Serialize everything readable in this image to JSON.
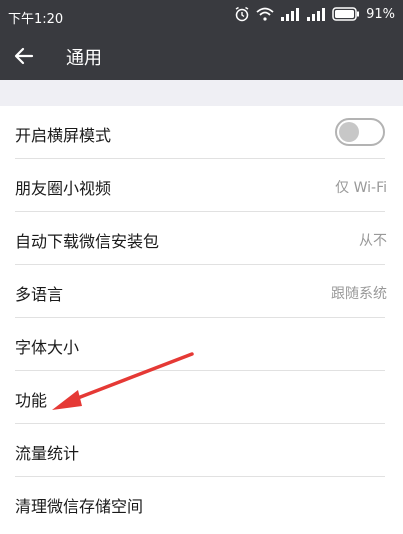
{
  "status_bar": {
    "time": "下午1:20",
    "battery": "91%"
  },
  "header": {
    "title": "通用"
  },
  "settings": [
    {
      "label": "开启横屏模式",
      "value": "",
      "type": "toggle",
      "toggle_on": false
    },
    {
      "label": "朋友圈小视频",
      "value": "仅 Wi-Fi"
    },
    {
      "label": "自动下载微信安装包",
      "value": "从不"
    },
    {
      "label": "多语言",
      "value": "跟随系统"
    },
    {
      "label": "字体大小",
      "value": ""
    },
    {
      "label": "功能",
      "value": ""
    },
    {
      "label": "流量统计",
      "value": ""
    },
    {
      "label": "清理微信存储空间",
      "value": ""
    }
  ],
  "colors": {
    "bar": "#393a3f",
    "annotation_arrow": "#e53935"
  }
}
